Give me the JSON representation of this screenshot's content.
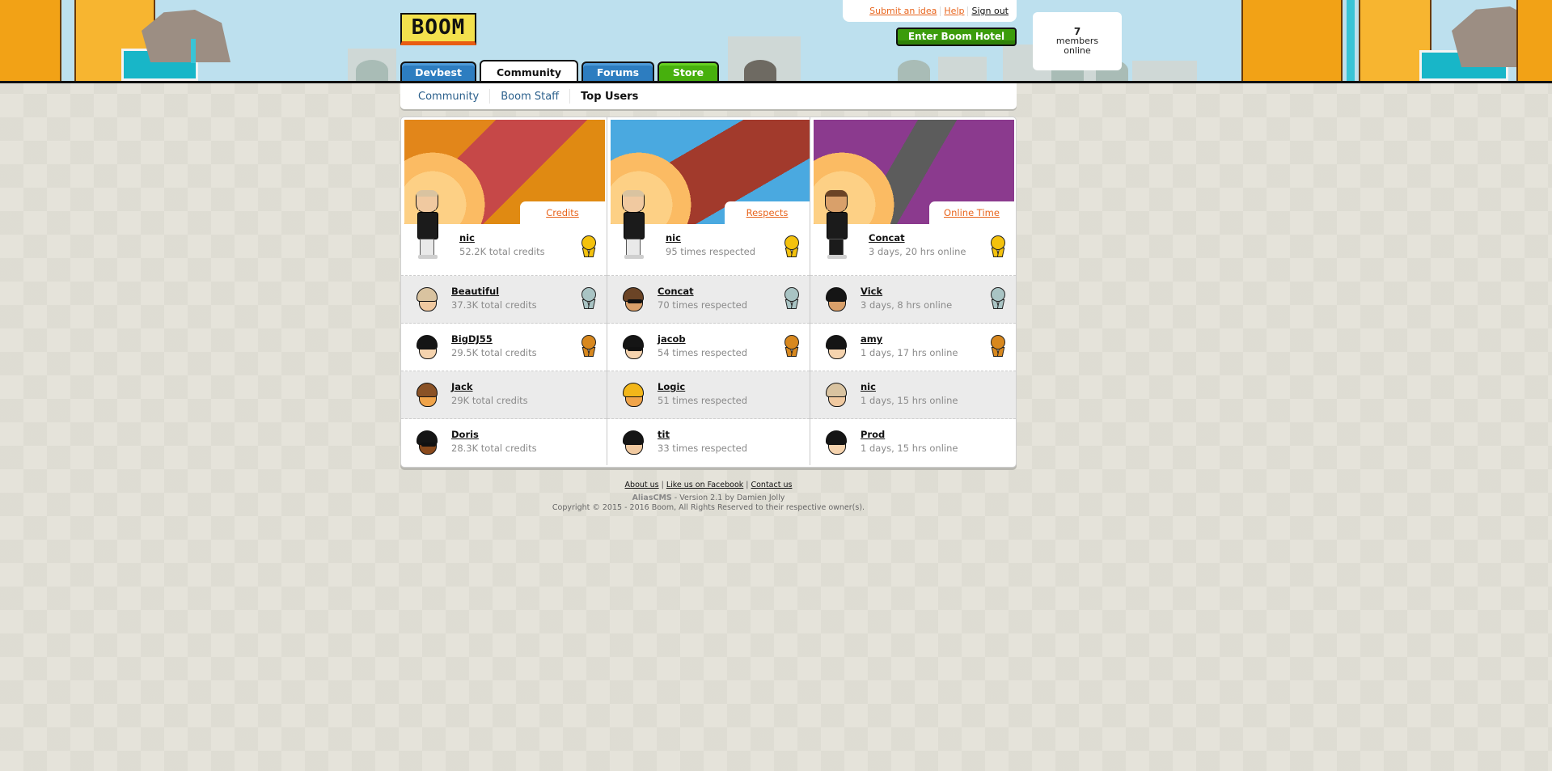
{
  "header": {
    "logo_text": "BOOM",
    "top_links": [
      {
        "label": "Submit an idea",
        "style": "orange"
      },
      {
        "label": "Help",
        "style": "orange"
      },
      {
        "label": "Sign out",
        "style": "black"
      }
    ],
    "enter_button": "Enter Boom Hotel",
    "online": {
      "count": "7",
      "line1": "members",
      "line2": "online"
    },
    "tabs": [
      {
        "label": "Devbest",
        "color": "blue",
        "active": false
      },
      {
        "label": "Community",
        "color": "white",
        "active": true
      },
      {
        "label": "Forums",
        "color": "blue",
        "active": false
      },
      {
        "label": "Store",
        "color": "green",
        "active": false
      }
    ]
  },
  "subnav": [
    {
      "label": "Community",
      "current": false
    },
    {
      "label": "Boom Staff",
      "current": false
    },
    {
      "label": "Top Users",
      "current": true
    }
  ],
  "colors": {
    "accent_orange": "#e8641c",
    "link_blue": "#2a5f8b",
    "gold": "#f4c20d",
    "silver": "#a9c4c4",
    "bronze": "#d8881e"
  },
  "columns": [
    {
      "category": "Credits",
      "banner": "builders-scene",
      "users": [
        {
          "name": "nic",
          "stat": "52.2K total credits",
          "medal": "gold"
        },
        {
          "name": "Beautiful",
          "stat": "37.3K total credits",
          "medal": "silver"
        },
        {
          "name": "BigDJ55",
          "stat": "29.5K total credits",
          "medal": "bronze"
        },
        {
          "name": "Jack",
          "stat": "29K total credits",
          "medal": ""
        },
        {
          "name": "Doris",
          "stat": "28.3K total credits",
          "medal": ""
        }
      ]
    },
    {
      "category": "Respects",
      "banner": "race-track-scene",
      "users": [
        {
          "name": "nic",
          "stat": "95 times respected",
          "medal": "gold"
        },
        {
          "name": "Concat",
          "stat": "70 times respected",
          "medal": "silver"
        },
        {
          "name": "jacob",
          "stat": "54 times respected",
          "medal": "bronze"
        },
        {
          "name": "Logic",
          "stat": "51 times respected",
          "medal": ""
        },
        {
          "name": "tit",
          "stat": "33 times respected",
          "medal": ""
        }
      ]
    },
    {
      "category": "Online Time",
      "banner": "bbq-party-scene",
      "users": [
        {
          "name": "Concat",
          "stat": "3 days, 20 hrs online",
          "medal": "gold"
        },
        {
          "name": "Vick",
          "stat": "3 days, 8 hrs online",
          "medal": "silver"
        },
        {
          "name": "amy",
          "stat": "1 days, 17 hrs online",
          "medal": "bronze"
        },
        {
          "name": "nic",
          "stat": "1 days, 15 hrs online",
          "medal": ""
        },
        {
          "name": "Prod",
          "stat": "1 days, 15 hrs online",
          "medal": ""
        }
      ]
    }
  ],
  "footer": {
    "links": [
      "About us",
      "Like us on Facebook",
      "Contact us"
    ],
    "cms_name": "AliasCMS",
    "cms_version": " - Version 2.1 by Damien Jolly",
    "copyright": "Copyright © 2015 - 2016 Boom, All Rights Reserved to their respective owner(s)."
  }
}
